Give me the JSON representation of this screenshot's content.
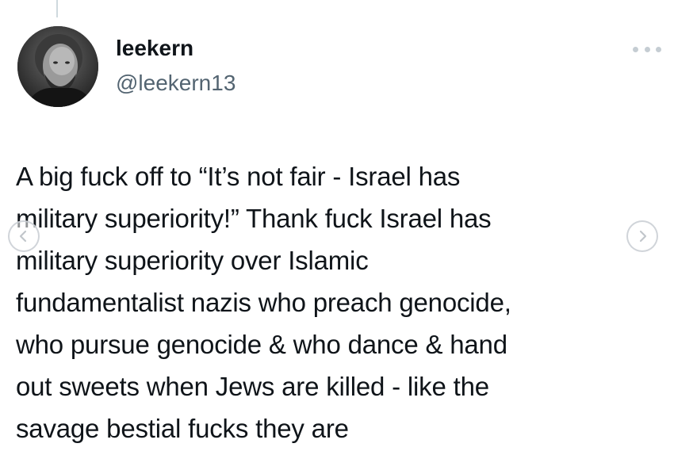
{
  "tweet": {
    "author": {
      "display_name": "leekern",
      "handle": "@leekern13",
      "avatar_icon": "user-avatar-photo"
    },
    "text": "A big fuck off to “It’s not fair - Israel has\nmilitary superiority!” Thank fuck Israel has\nmilitary superiority over Islamic\nfundamentalist nazis who preach genocide,\nwho pursue genocide & who dance & hand\nout sweets when Jews are killed - like the\nsavage bestial fucks they are",
    "more_icon": "more-horizontal-icon"
  },
  "carousel": {
    "prev_icon": "chevron-left-icon",
    "next_icon": "chevron-right-icon"
  },
  "colors": {
    "text": "#0f1419",
    "secondary": "#536471",
    "thread_line": "#cfd9de"
  }
}
